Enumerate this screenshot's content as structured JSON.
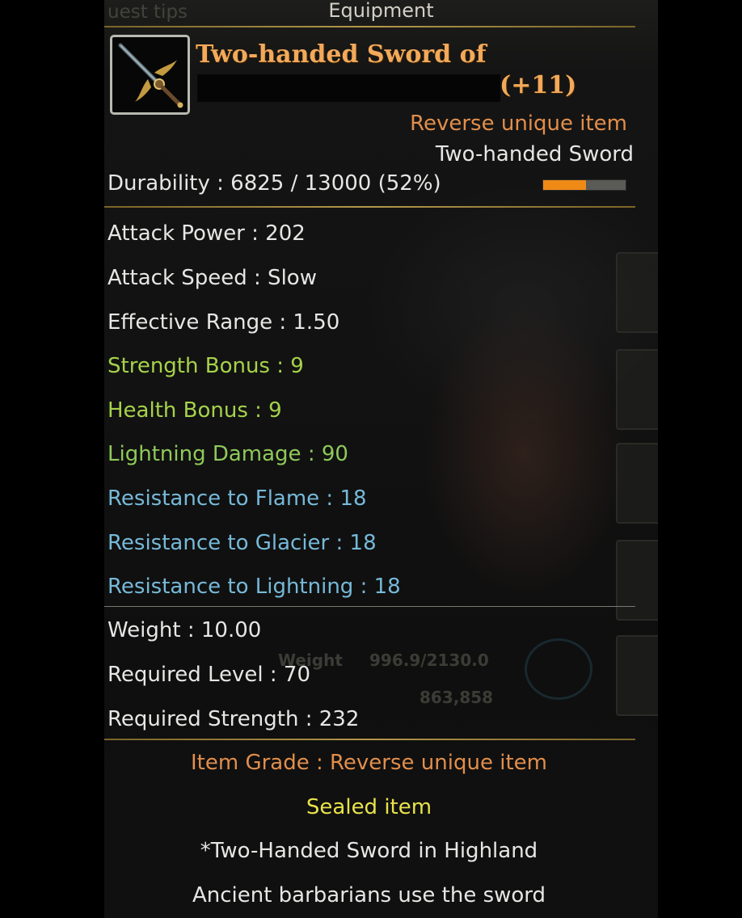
{
  "window": {
    "title": "Equipment",
    "bg_tab": "uest tips"
  },
  "item": {
    "name_line1": "Two-handed Sword of",
    "name_line2": "(+11)",
    "rarity": "Reverse unique item",
    "type": "Two-handed Sword",
    "icon": "sword-icon"
  },
  "durability": {
    "text": "Durability : 6825 / 13000 (52%)",
    "current": 6825,
    "max": 13000,
    "percent": 52
  },
  "stats": [
    {
      "text": "Attack Power : 202",
      "color": "white"
    },
    {
      "text": "Attack Speed : Slow",
      "color": "white"
    },
    {
      "text": "Effective Range : 1.50",
      "color": "white"
    },
    {
      "text": "Strength Bonus : 9",
      "color": "green"
    },
    {
      "text": "Health Bonus : 9",
      "color": "green"
    },
    {
      "text": "Lightning Damage : 90",
      "color": "green"
    },
    {
      "text": "Resistance to Flame : 18",
      "color": "blue"
    },
    {
      "text": "Resistance to Glacier : 18",
      "color": "blue"
    },
    {
      "text": "Resistance to Lightning : 18",
      "color": "blue"
    }
  ],
  "requirements": [
    {
      "text": "Weight : 10.00"
    },
    {
      "text": "Required Level : 70"
    },
    {
      "text": "Required Strength : 232"
    }
  ],
  "footer": {
    "grade": "Item Grade : Reverse unique item",
    "sealed": "Sealed item",
    "desc1": "*Two-Handed Sword in Highland",
    "desc2": "Ancient barbarians use the sword"
  },
  "background": {
    "weight_label": "Weight",
    "weight_value": "996.9/2130.0",
    "gold_value": "863,858"
  },
  "colors": {
    "name": "#f2a95a",
    "rarity": "#e28e4b",
    "white": "#e6e6e4",
    "green": "#a6d24a",
    "blue": "#76b9d8",
    "yellow": "#e8e34a",
    "durability_fill": "#f08a17"
  }
}
